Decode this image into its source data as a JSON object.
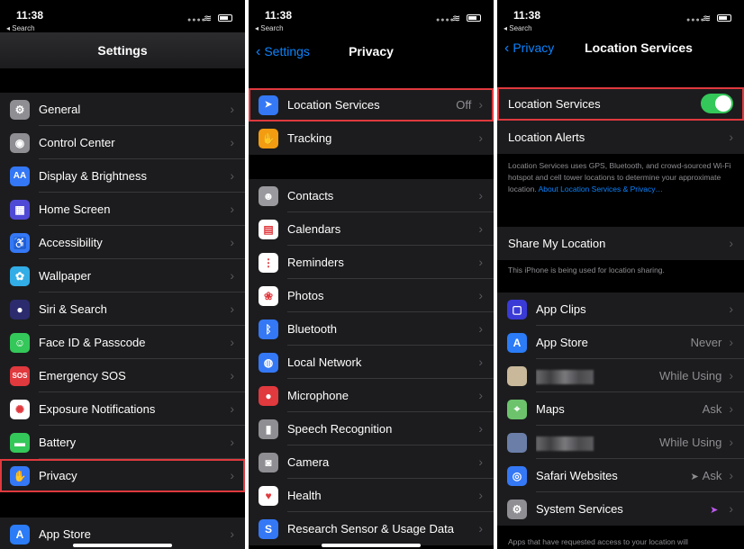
{
  "status_time": "11:38",
  "status_back": "◂ Search",
  "panel1": {
    "title": "Settings",
    "items": [
      {
        "label": "General",
        "icon": "gear-icon",
        "glyph": "⚙",
        "color": "#8e8e93"
      },
      {
        "label": "Control Center",
        "icon": "toggles-icon",
        "glyph": "◉",
        "color": "#8e8e93"
      },
      {
        "label": "Display & Brightness",
        "icon": "display-brightness-icon",
        "glyph": "AA",
        "color": "#3478f6"
      },
      {
        "label": "Home Screen",
        "icon": "home-screen-icon",
        "glyph": "▦",
        "color": "#4e4ad6"
      },
      {
        "label": "Accessibility",
        "icon": "accessibility-icon",
        "glyph": "♿",
        "color": "#3478f6"
      },
      {
        "label": "Wallpaper",
        "icon": "wallpaper-icon",
        "glyph": "✿",
        "color": "#32ade6"
      },
      {
        "label": "Siri & Search",
        "icon": "siri-icon",
        "glyph": "●",
        "color": "#2b2b6e"
      },
      {
        "label": "Face ID & Passcode",
        "icon": "face-id-icon",
        "glyph": "☺",
        "color": "#34c759"
      },
      {
        "label": "Emergency SOS",
        "icon": "sos-icon",
        "glyph": "SOS",
        "color": "#e0393e"
      },
      {
        "label": "Exposure Notifications",
        "icon": "exposure-icon",
        "glyph": "✺",
        "color": "#ffffff"
      },
      {
        "label": "Battery",
        "icon": "battery-icon",
        "glyph": "▬",
        "color": "#34c759"
      },
      {
        "label": "Privacy",
        "icon": "hand-icon",
        "glyph": "✋",
        "color": "#3478f6"
      }
    ],
    "app_store": {
      "label": "App Store",
      "icon": "app-store-icon",
      "glyph": "A",
      "color": "#2b7cf6"
    }
  },
  "panel2": {
    "back": "Settings",
    "title": "Privacy",
    "location": {
      "label": "Location Services",
      "value": "Off",
      "icon": "location-arrow-icon",
      "glyph": "➤",
      "color": "#3478f6"
    },
    "tracking": {
      "label": "Tracking",
      "icon": "tracking-icon",
      "glyph": "✋",
      "color": "#f39c12"
    },
    "items": [
      {
        "label": "Contacts",
        "icon": "contacts-icon",
        "glyph": "☻",
        "color": "#9a9a9e"
      },
      {
        "label": "Calendars",
        "icon": "calendar-icon",
        "glyph": "▤",
        "color": "#ffffff"
      },
      {
        "label": "Reminders",
        "icon": "reminders-icon",
        "glyph": "⋮",
        "color": "#ffffff"
      },
      {
        "label": "Photos",
        "icon": "photos-icon",
        "glyph": "❀",
        "color": "#ffffff"
      },
      {
        "label": "Bluetooth",
        "icon": "bluetooth-icon",
        "glyph": "ᛒ",
        "color": "#3478f6"
      },
      {
        "label": "Local Network",
        "icon": "globe-icon",
        "glyph": "◍",
        "color": "#3478f6"
      },
      {
        "label": "Microphone",
        "icon": "microphone-icon",
        "glyph": "●",
        "color": "#e0393e"
      },
      {
        "label": "Speech Recognition",
        "icon": "speech-icon",
        "glyph": "▮",
        "color": "#8e8e93"
      },
      {
        "label": "Camera",
        "icon": "camera-icon",
        "glyph": "◙",
        "color": "#8e8e93"
      },
      {
        "label": "Health",
        "icon": "heart-icon",
        "glyph": "♥",
        "color": "#ffffff"
      },
      {
        "label": "Research Sensor & Usage Data",
        "icon": "research-icon",
        "glyph": "S",
        "color": "#3478f6"
      }
    ]
  },
  "panel3": {
    "back": "Privacy",
    "title": "Location Services",
    "toggle_label": "Location Services",
    "alerts_label": "Location Alerts",
    "description": "Location Services uses GPS, Bluetooth, and crowd-sourced Wi-Fi hotspot and cell tower locations to determine your approximate location.",
    "about_link": "About Location Services & Privacy…",
    "share_label": "Share My Location",
    "share_note": "This iPhone is being used for location sharing.",
    "apps": [
      {
        "label": "App Clips",
        "value": "",
        "icon": "app-clips-icon",
        "glyph": "▢",
        "color": "#3a3ad6",
        "blur": false
      },
      {
        "label": "App Store",
        "value": "Never",
        "icon": "app-store-icon",
        "glyph": "A",
        "color": "#2b7cf6",
        "blur": false
      },
      {
        "label": "",
        "value": "While Using",
        "icon": "blurred-app-icon",
        "glyph": "",
        "color": "#c9b89a",
        "blur": true
      },
      {
        "label": "Maps",
        "value": "Ask",
        "icon": "maps-icon",
        "glyph": "⌖",
        "color": "#6cc36c",
        "blur": false
      },
      {
        "label": "",
        "value": "While Using",
        "icon": "blurred-app-icon",
        "glyph": "",
        "color": "#6a7ea8",
        "blur": true
      },
      {
        "label": "Safari Websites",
        "value": "Ask",
        "icon": "safari-icon",
        "glyph": "◎",
        "color": "#3478f6",
        "blur": false,
        "arrow": "gray"
      },
      {
        "label": "System Services",
        "value": "",
        "icon": "gear-icon",
        "glyph": "⚙",
        "color": "#8e8e93",
        "blur": false,
        "arrow": "purple"
      }
    ],
    "bottom_note": "Apps that have requested access to your location will"
  }
}
